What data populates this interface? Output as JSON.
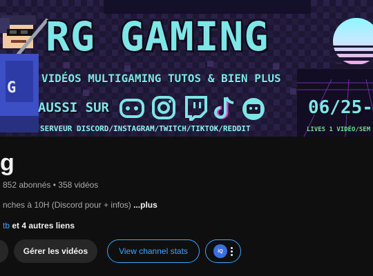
{
  "banner": {
    "headline": "RG GAMING",
    "tagline": "VIDÉOS MULTIGAMING TUTOS & BIEN PLUS",
    "also_on": "AUSSI SUR",
    "platforms_line": "SERVEUR DISCORD/INSTAGRAM/TWITCH/TIKTOK/REDDIT",
    "schedule": "06/25-",
    "lives_line": "LIVES   1 VIDÉO/SEM",
    "social_icons": [
      "discord-icon",
      "instagram-icon",
      "twitch-icon",
      "tiktok-icon",
      "reddit-tv-icon"
    ],
    "colors": {
      "accent": "#7fe6e8",
      "background": "#1c1530",
      "lives_green": "#6fe08c"
    }
  },
  "channel": {
    "name": "g",
    "stats": "852 abonnés • 358 vidéos",
    "description": "nches à 10H (Discord pour  + infos)",
    "more_label": "...plus",
    "link_text": "tb",
    "other_links": " et 4 autres liens"
  },
  "actions": {
    "manage_videos": "Gérer les vidéos",
    "view_stats": "View channel stats",
    "extension_badge": "iQ"
  },
  "colors": {
    "link_blue": "#3ea6ff",
    "page_bg": "#0f0f0f",
    "button_bg": "#272727"
  }
}
